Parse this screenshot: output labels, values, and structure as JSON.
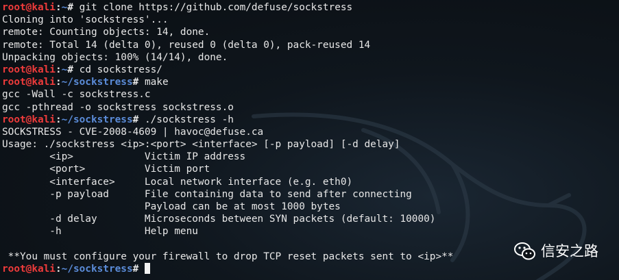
{
  "prompt": {
    "user": "root@kali",
    "sep": ":"
  },
  "lines": [
    {
      "type": "prompt",
      "path": "~",
      "cmd": "git clone https://github.com/defuse/sockstress"
    },
    {
      "type": "out",
      "text": "Cloning into 'sockstress'..."
    },
    {
      "type": "out",
      "text": "remote: Counting objects: 14, done."
    },
    {
      "type": "out",
      "text": "remote: Total 14 (delta 0), reused 0 (delta 0), pack-reused 14"
    },
    {
      "type": "out",
      "text": "Unpacking objects: 100% (14/14), done."
    },
    {
      "type": "prompt",
      "path": "~",
      "cmd": "cd sockstress/"
    },
    {
      "type": "prompt",
      "path": "~/sockstress",
      "cmd": "make"
    },
    {
      "type": "out",
      "text": "gcc -Wall -c sockstress.c"
    },
    {
      "type": "out",
      "text": "gcc -pthread -o sockstress sockstress.o"
    },
    {
      "type": "prompt",
      "path": "~/sockstress",
      "cmd": "./sockstress -h"
    },
    {
      "type": "out",
      "text": "SOCKSTRESS - CVE-2008-4609 | havoc@defuse.ca"
    },
    {
      "type": "out",
      "text": "Usage: ./sockstress <ip>:<port> <interface> [-p payload] [-d delay]"
    },
    {
      "type": "out",
      "text": "        <ip>            Victim IP address"
    },
    {
      "type": "out",
      "text": "        <port>          Victim port"
    },
    {
      "type": "out",
      "text": "        <interface>     Local network interface (e.g. eth0)"
    },
    {
      "type": "out",
      "text": "        -p payload      File containing data to send after connecting"
    },
    {
      "type": "out",
      "text": "                        Payload can be at most 1000 bytes"
    },
    {
      "type": "out",
      "text": "        -d delay        Microseconds between SYN packets (default: 10000)"
    },
    {
      "type": "out",
      "text": "        -h              Help menu"
    },
    {
      "type": "out",
      "text": ""
    },
    {
      "type": "out",
      "text": " **You must configure your firewall to drop TCP reset packets sent to <ip>**"
    },
    {
      "type": "prompt",
      "path": "~/sockstress",
      "cmd": "",
      "cursor": true
    }
  ],
  "watermark": {
    "text": "信安之路",
    "icon": "wechat-icon"
  }
}
